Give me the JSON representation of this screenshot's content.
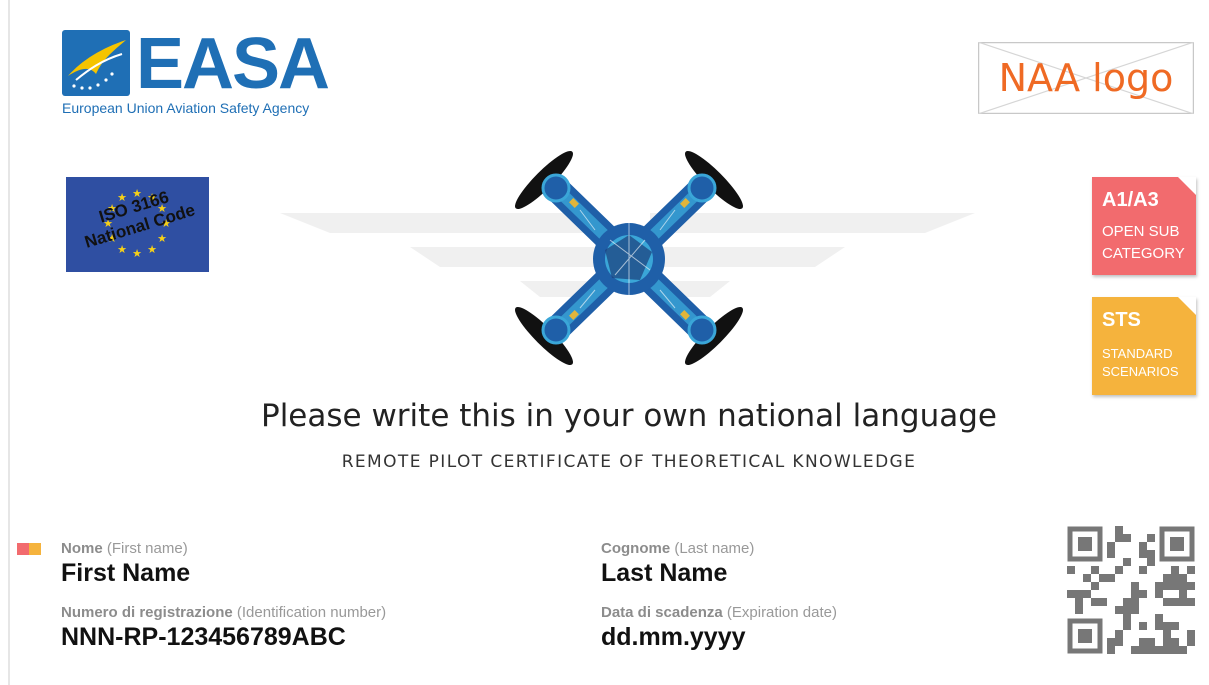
{
  "header": {
    "easa_wordmark": "EASA",
    "easa_tagline": "European Union Aviation Safety Agency",
    "naa_logo_text": "NAA logo"
  },
  "flag": {
    "label_line1": "ISO 3166",
    "label_line2": "National Code"
  },
  "badges": [
    {
      "code": "A1/A3",
      "line1": "OPEN SUB",
      "line2": "CATEGORY",
      "color": "#f26b6e"
    },
    {
      "code": "STS",
      "line1": "STANDARD",
      "line2": "SCENARIOS",
      "color": "#f5b33d"
    }
  ],
  "titles": {
    "main": "Please write this in your own national language",
    "sub": "REMOTE PILOT CERTIFICATE OF THEORETICAL KNOWLEDGE"
  },
  "fields": {
    "first_name": {
      "label": "Nome",
      "label_en": "(First name)",
      "value": "First Name"
    },
    "last_name": {
      "label": "Cognome",
      "label_en": "(Last name)",
      "value": "Last Name"
    },
    "id_number": {
      "label": "Numero di registrazione",
      "label_en": "(Identification number)",
      "value": "NNN-RP-123456789ABC"
    },
    "expiration": {
      "label": "Data di scadenza",
      "label_en": "(Expiration date)",
      "value": "dd.mm.yyyy"
    }
  },
  "colors": {
    "easa_blue": "#1f6fb5",
    "naa_orange": "#ef6a24",
    "marker_red": "#f26b6e",
    "marker_yellow": "#f5b33d",
    "eu_blue": "#2f4fa2",
    "eu_star": "#f7d117"
  }
}
